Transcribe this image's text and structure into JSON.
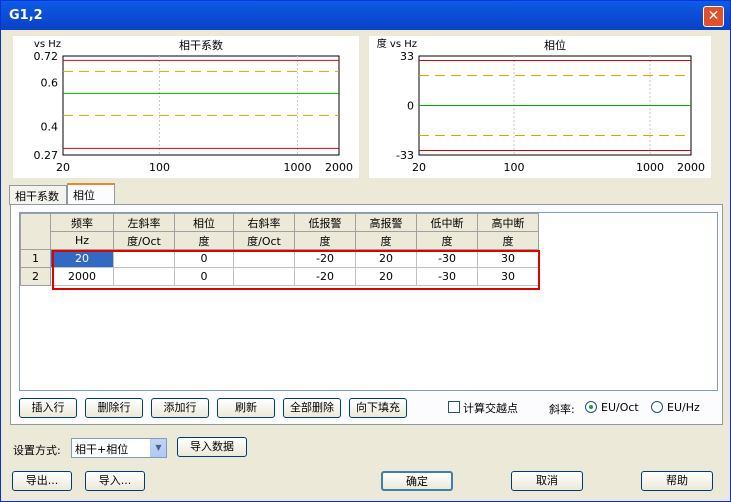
{
  "window": {
    "title": "G1,2",
    "close_label": "✕"
  },
  "colors": {
    "limit_line": "#e00000",
    "alarm_line": "#e0a000",
    "reference_line": "#00b000",
    "grid": "#c8c8c8",
    "selection": "#e00000"
  },
  "charts": [
    {
      "ylabel": "vs Hz",
      "title": "相干系数",
      "y_ticks": [
        "0.72",
        "0.6",
        "0.4",
        "0.27"
      ],
      "x_ticks": [
        "20",
        "100",
        "1000",
        "2000"
      ]
    },
    {
      "ylabel": "度 vs Hz",
      "title": "相位",
      "y_ticks": [
        "33",
        "0",
        "-33"
      ],
      "x_ticks": [
        "20",
        "100",
        "1000",
        "2000"
      ]
    }
  ],
  "chart_data": [
    {
      "type": "line",
      "title": "相干系数",
      "xlabel": "",
      "ylabel": "vs Hz",
      "x_scale": "log",
      "xlim": [
        20,
        2000
      ],
      "ylim": [
        0.27,
        0.72
      ],
      "series": [
        {
          "x": [
            20,
            2000
          ],
          "values": [
            0.7,
            0.7
          ]
        },
        {
          "x": [
            20,
            2000
          ],
          "values": [
            0.65,
            0.65
          ]
        },
        {
          "x": [
            20,
            2000
          ],
          "values": [
            0.55,
            0.55
          ]
        },
        {
          "x": [
            20,
            2000
          ],
          "values": [
            0.45,
            0.45
          ]
        },
        {
          "x": [
            20,
            2000
          ],
          "values": [
            0.3,
            0.3
          ]
        }
      ]
    },
    {
      "type": "line",
      "title": "相位",
      "xlabel": "",
      "ylabel": "度 vs Hz",
      "x_scale": "log",
      "xlim": [
        20,
        2000
      ],
      "ylim": [
        -33,
        33
      ],
      "series": [
        {
          "x": [
            20,
            2000
          ],
          "values": [
            30,
            30
          ]
        },
        {
          "x": [
            20,
            2000
          ],
          "values": [
            20,
            20
          ]
        },
        {
          "x": [
            20,
            2000
          ],
          "values": [
            0,
            0
          ]
        },
        {
          "x": [
            20,
            2000
          ],
          "values": [
            -20,
            -20
          ]
        },
        {
          "x": [
            20,
            2000
          ],
          "values": [
            -30,
            -30
          ]
        }
      ]
    }
  ],
  "tabs": [
    {
      "label": "相干系数"
    },
    {
      "label": "相位"
    }
  ],
  "table": {
    "columns": [
      {
        "name": "频率",
        "unit": "Hz"
      },
      {
        "name": "左斜率",
        "unit": "度/Oct"
      },
      {
        "name": "相位",
        "unit": "度"
      },
      {
        "name": "右斜率",
        "unit": "度/Oct"
      },
      {
        "name": "低报警",
        "unit": "度"
      },
      {
        "name": "高报警",
        "unit": "度"
      },
      {
        "name": "低中断",
        "unit": "度"
      },
      {
        "name": "高中断",
        "unit": "度"
      }
    ],
    "rows": [
      {
        "index": "1",
        "cells": [
          "20",
          "",
          "0",
          "",
          "-20",
          "20",
          "-30",
          "30"
        ]
      },
      {
        "index": "2",
        "cells": [
          "2000",
          "",
          "0",
          "",
          "-20",
          "20",
          "-30",
          "30"
        ]
      }
    ]
  },
  "buttons": {
    "insert_row": "插入行",
    "delete_row": "删除行",
    "add_row": "添加行",
    "refresh": "刷新",
    "delete_all": "全部删除",
    "fill_down": "向下填充",
    "import_data": "导入数据",
    "export": "导出...",
    "import": "导入...",
    "ok": "确定",
    "cancel": "取消",
    "help": "帮助"
  },
  "checkbox": {
    "label": "计算交越点",
    "checked": false
  },
  "slope": {
    "label": "斜率:",
    "options": [
      "EU/Oct",
      "EU/Hz"
    ],
    "selected": "EU/Oct"
  },
  "settings": {
    "label": "设置方式:",
    "value": "相干+相位"
  }
}
